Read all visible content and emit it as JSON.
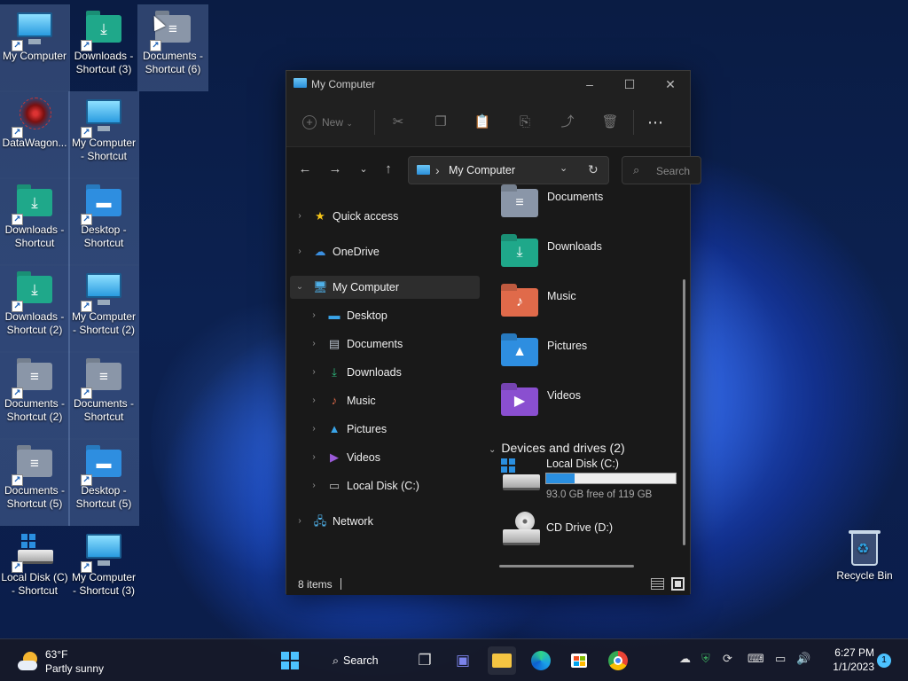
{
  "colors": {
    "accent": "#0078d4",
    "folder_blue": "#2e8ee0",
    "folder_green": "#1fa88a",
    "folder_gray": "#8a96a8",
    "progress": "#2a8fe0"
  },
  "desktop": {
    "icons": [
      {
        "label": "My Computer",
        "icon": "monitor-icon"
      },
      {
        "label": "Downloads - Shortcut (3)",
        "icon": "downloads-folder-icon"
      },
      {
        "label": "Documents - Shortcut (6)",
        "icon": "documents-folder-icon"
      },
      {
        "label": "DataWagon...",
        "icon": "datawagon-icon"
      },
      {
        "label": "My Computer - Shortcut",
        "icon": "monitor-icon"
      },
      {
        "label": "Downloads - Shortcut",
        "icon": "downloads-folder-icon"
      },
      {
        "label": "Desktop - Shortcut",
        "icon": "desktop-folder-icon"
      },
      {
        "label": "Downloads - Shortcut (2)",
        "icon": "downloads-folder-icon"
      },
      {
        "label": "My Computer - Shortcut (2)",
        "icon": "monitor-icon"
      },
      {
        "label": "Documents - Shortcut (2)",
        "icon": "documents-folder-icon"
      },
      {
        "label": "Documents - Shortcut",
        "icon": "documents-folder-icon"
      },
      {
        "label": "Documents - Shortcut (5)",
        "icon": "documents-folder-icon"
      },
      {
        "label": "Desktop - Shortcut (5)",
        "icon": "desktop-folder-icon"
      },
      {
        "label": "Local Disk (C) - Shortcut",
        "icon": "drive-icon"
      },
      {
        "label": "My Computer - Shortcut (3)",
        "icon": "monitor-icon"
      }
    ],
    "recycle_bin": "Recycle Bin"
  },
  "window": {
    "title": "My Computer",
    "controls": {
      "minimize": "–",
      "maximize": "☐",
      "close": "✕"
    },
    "commandbar": {
      "new_label": "New"
    },
    "address": {
      "location": "My Computer",
      "separator": "›"
    },
    "search": {
      "placeholder": "Search"
    },
    "tree": [
      {
        "label": "Quick access",
        "icon": "star-icon",
        "glyph": "★",
        "color": "#f5c518"
      },
      {
        "label": "OneDrive",
        "icon": "cloud-icon",
        "glyph": "☁",
        "color": "#3b8fe0"
      },
      {
        "label": "My Computer",
        "icon": "monitor-icon",
        "glyph": "🖥",
        "color": "#4fb0e8"
      },
      {
        "label": "Desktop",
        "icon": "desktop-icon",
        "glyph": "▬",
        "color": "#3aa4e8"
      },
      {
        "label": "Documents",
        "icon": "document-icon",
        "glyph": "▤",
        "color": "#b8c0cc"
      },
      {
        "label": "Downloads",
        "icon": "download-icon",
        "glyph": "⤓",
        "color": "#2fbf80"
      },
      {
        "label": "Music",
        "icon": "music-icon",
        "glyph": "♪",
        "color": "#e06a4a"
      },
      {
        "label": "Pictures",
        "icon": "pictures-icon",
        "glyph": "▲",
        "color": "#3aa4e8"
      },
      {
        "label": "Videos",
        "icon": "video-icon",
        "glyph": "▶",
        "color": "#9a5ad8"
      },
      {
        "label": "Local Disk (C:)",
        "icon": "drive-icon",
        "glyph": "▭",
        "color": "#bbbbbb"
      },
      {
        "label": "Network",
        "icon": "network-icon",
        "glyph": "🖧",
        "color": "#4fb0e8"
      }
    ],
    "folders": [
      {
        "label": "Documents",
        "icon": "documents-folder-icon",
        "glyph": "≡",
        "color": "#8a96a8"
      },
      {
        "label": "Downloads",
        "icon": "downloads-folder-icon",
        "glyph": "⤓",
        "color": "#1fa88a"
      },
      {
        "label": "Music",
        "icon": "music-folder-icon",
        "glyph": "♪",
        "color": "#e06a4a"
      },
      {
        "label": "Pictures",
        "icon": "pictures-folder-icon",
        "glyph": "▲",
        "color": "#2e8ee0"
      },
      {
        "label": "Videos",
        "icon": "videos-folder-icon",
        "glyph": "▶",
        "color": "#8a4fd0"
      }
    ],
    "devices": {
      "header": "Devices and drives (2)",
      "drives": [
        {
          "label": "Local Disk (C:)",
          "free_text": "93.0 GB free of 119 GB",
          "used_fraction": 0.22
        },
        {
          "label": "CD Drive (D:)"
        }
      ]
    },
    "status": {
      "items": "8 items"
    }
  },
  "taskbar": {
    "weather": {
      "temp": "63°F",
      "desc": "Partly sunny"
    },
    "search_label": "Search",
    "clock": {
      "time": "6:27 PM",
      "date": "1/1/2023"
    },
    "notification_count": "1"
  }
}
